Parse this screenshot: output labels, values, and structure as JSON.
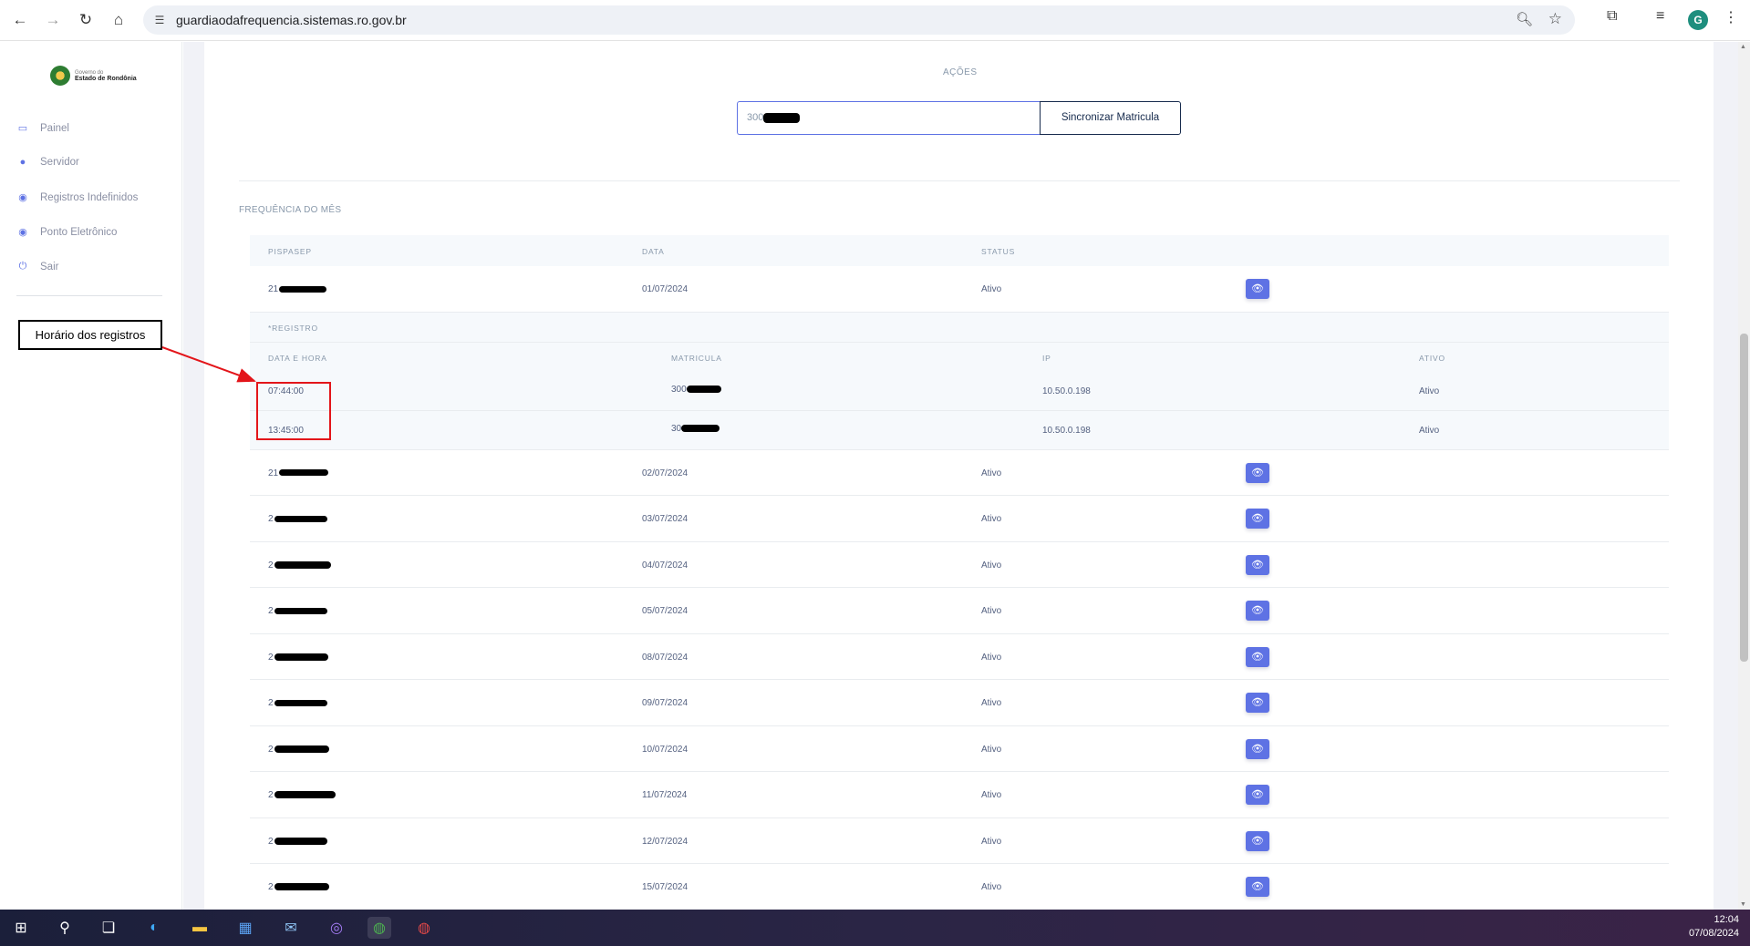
{
  "browser": {
    "url": "guardiaodafrequencia.sistemas.ro.gov.br",
    "profile_initial": "G"
  },
  "sidebar": {
    "logo": {
      "line1": "Governo do",
      "line2": "Estado de Rondônia"
    },
    "items": [
      {
        "label": "Painel",
        "icon": "monitor-icon"
      },
      {
        "label": "Servidor",
        "icon": "user-icon"
      },
      {
        "label": "Registros Indefinidos",
        "icon": "pin-icon"
      },
      {
        "label": "Ponto Eletrônico",
        "icon": "pin-icon"
      },
      {
        "label": "Sair",
        "icon": "power-icon"
      }
    ]
  },
  "annotation": {
    "label": "Horário dos registros"
  },
  "actions": {
    "title": "AÇÕES",
    "input_prefix": "300",
    "sync_label": "Sincronizar Matricula"
  },
  "frequency": {
    "title": "FREQUÊNCIA DO MÊS",
    "headers": {
      "pispasep": "PISPASEP",
      "data": "DATA",
      "status": "STATUS"
    },
    "expanded": {
      "title": "*REGISTRO",
      "headers": {
        "datetime": "DATA E HORA",
        "matricula": "MATRICULA",
        "ip": "IP",
        "ativo": "ATIVO"
      },
      "rows": [
        {
          "time": "07:44:00",
          "matricula_prefix": "300",
          "ip": "10.50.0.198",
          "ativo": "Ativo"
        },
        {
          "time": "13:45:00",
          "matricula_prefix": "30",
          "ip": "10.50.0.198",
          "ativo": "Ativo"
        }
      ]
    },
    "rows": [
      {
        "pis_prefix": "21",
        "date": "01/07/2024",
        "status": "Ativo"
      },
      {
        "pis_prefix": "21",
        "date": "02/07/2024",
        "status": "Ativo"
      },
      {
        "pis_prefix": "2",
        "date": "03/07/2024",
        "status": "Ativo"
      },
      {
        "pis_prefix": "2",
        "date": "04/07/2024",
        "status": "Ativo"
      },
      {
        "pis_prefix": "2",
        "date": "05/07/2024",
        "status": "Ativo"
      },
      {
        "pis_prefix": "2",
        "date": "08/07/2024",
        "status": "Ativo"
      },
      {
        "pis_prefix": "2",
        "date": "09/07/2024",
        "status": "Ativo"
      },
      {
        "pis_prefix": "2",
        "date": "10/07/2024",
        "status": "Ativo"
      },
      {
        "pis_prefix": "2",
        "date": "11/07/2024",
        "status": "Ativo"
      },
      {
        "pis_prefix": "2",
        "date": "12/07/2024",
        "status": "Ativo"
      },
      {
        "pis_prefix": "2",
        "date": "15/07/2024",
        "status": "Ativo"
      }
    ]
  },
  "taskbar": {
    "time": "12:04",
    "date": "07/08/2024"
  },
  "colors": {
    "accent": "#5e72e4",
    "annotation_red": "#e3151a"
  }
}
